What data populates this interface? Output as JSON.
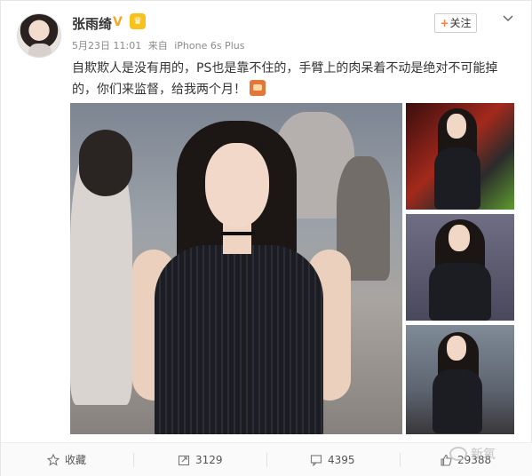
{
  "post": {
    "username": "张雨绮",
    "verified_icon": "verified-v-icon",
    "member_icon": "crown-icon",
    "date": "5月23日 11:01",
    "source_prefix": "来自",
    "source": "iPhone 6s Plus",
    "follow_label": "关注",
    "text": "自欺欺人是没有用的，PS也是靠不住的，手臂上的肉呆着不动是绝对不可能掉的，你们来监督，给我两个月！"
  },
  "actions": {
    "favorite_label": "收藏",
    "repost_count": "3129",
    "comment_count": "4395",
    "like_count": "29388"
  },
  "watermark": {
    "text": "新氧"
  },
  "colors": {
    "accent": "#ff8140",
    "verified": "#f5a623",
    "text": "#333333",
    "meta": "#8a8a8a"
  }
}
